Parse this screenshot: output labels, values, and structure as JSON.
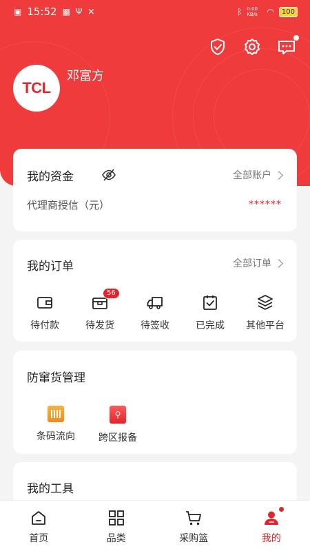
{
  "status_bar": {
    "time": "15:52",
    "net_speed": "0.00 KB/s",
    "battery": "100"
  },
  "profile": {
    "avatar_text": "TCL",
    "name": "邓富方"
  },
  "funds": {
    "title": "我的资金",
    "link": "全部账户",
    "credit_label": "代理商授信（元）",
    "credit_value": "******"
  },
  "orders": {
    "title": "我的订单",
    "link": "全部订单",
    "items": [
      {
        "label": "待付款",
        "icon": "wallet-icon"
      },
      {
        "label": "待发货",
        "icon": "box-icon",
        "badge": "56"
      },
      {
        "label": "待签收",
        "icon": "truck-icon"
      },
      {
        "label": "已完成",
        "icon": "clipboard-check-icon"
      },
      {
        "label": "其他平台",
        "icon": "layers-icon"
      }
    ]
  },
  "anti_diversion": {
    "title": "防窜货管理",
    "items": [
      {
        "label": "条码流向",
        "icon": "barcode-icon"
      },
      {
        "label": "跨区报备",
        "icon": "report-icon"
      }
    ]
  },
  "tools": {
    "title": "我的工具"
  },
  "tabbar": {
    "items": [
      {
        "label": "首页",
        "icon": "home-icon"
      },
      {
        "label": "品类",
        "icon": "grid-icon"
      },
      {
        "label": "采购篮",
        "icon": "cart-icon"
      },
      {
        "label": "我的",
        "icon": "user-icon",
        "active": true
      }
    ]
  },
  "colors": {
    "brand": "#ef3b3b",
    "accent": "#e3242b",
    "background": "#f4f4f4"
  }
}
